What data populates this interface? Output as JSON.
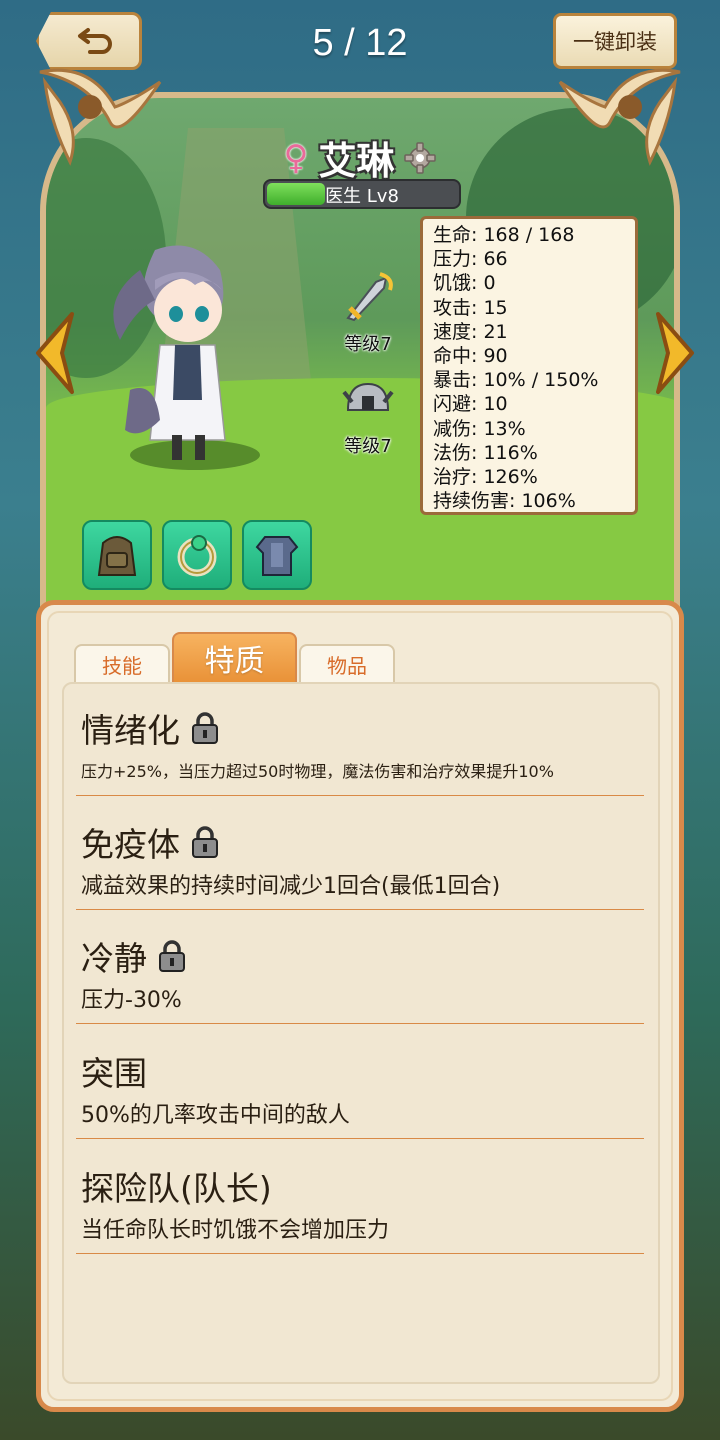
{
  "header": {
    "page_counter": "5 / 12",
    "unequip_label": "一键卸装"
  },
  "character": {
    "gender_symbol": "♀",
    "name": "艾琳",
    "class_level": "医生 Lv8",
    "xp_fraction": 0.3,
    "weapon_level": "等级7",
    "helmet_level": "等级7"
  },
  "stats": [
    "生命: 168 / 168",
    "压力: 66",
    "饥饿: 0",
    "攻击: 15",
    "速度: 21",
    "命中: 90",
    "暴击: 10% / 150%",
    "闪避: 10",
    "减伤: 13%",
    "法伤: 116%",
    "治疗: 126%",
    "持续伤害: 106%"
  ],
  "slots": [
    "backpack-icon",
    "ring-icon",
    "armor-icon"
  ],
  "tabs": {
    "skills": "技能",
    "traits": "特质",
    "items": "物品"
  },
  "traits": [
    {
      "title": "情绪化",
      "locked": true,
      "desc": "压力+25%，当压力超过50时物理，魔法伤害和治疗效果提升10%"
    },
    {
      "title": "免疫体",
      "locked": true,
      "desc": "减益效果的持续时间减少1回合(最低1回合)"
    },
    {
      "title": "冷静",
      "locked": true,
      "desc": "压力-30%"
    },
    {
      "title": "突围",
      "locked": false,
      "desc": "50%的几率攻击中间的敌人"
    },
    {
      "title": "探险队(队长)",
      "locked": false,
      "desc": "当任命队长时饥饿不会增加压力"
    }
  ],
  "colors": {
    "accent_orange": "#e99238",
    "panel_border": "#d8894a",
    "xp_green": "#3fae2c",
    "slot_teal": "#1fae7a"
  }
}
